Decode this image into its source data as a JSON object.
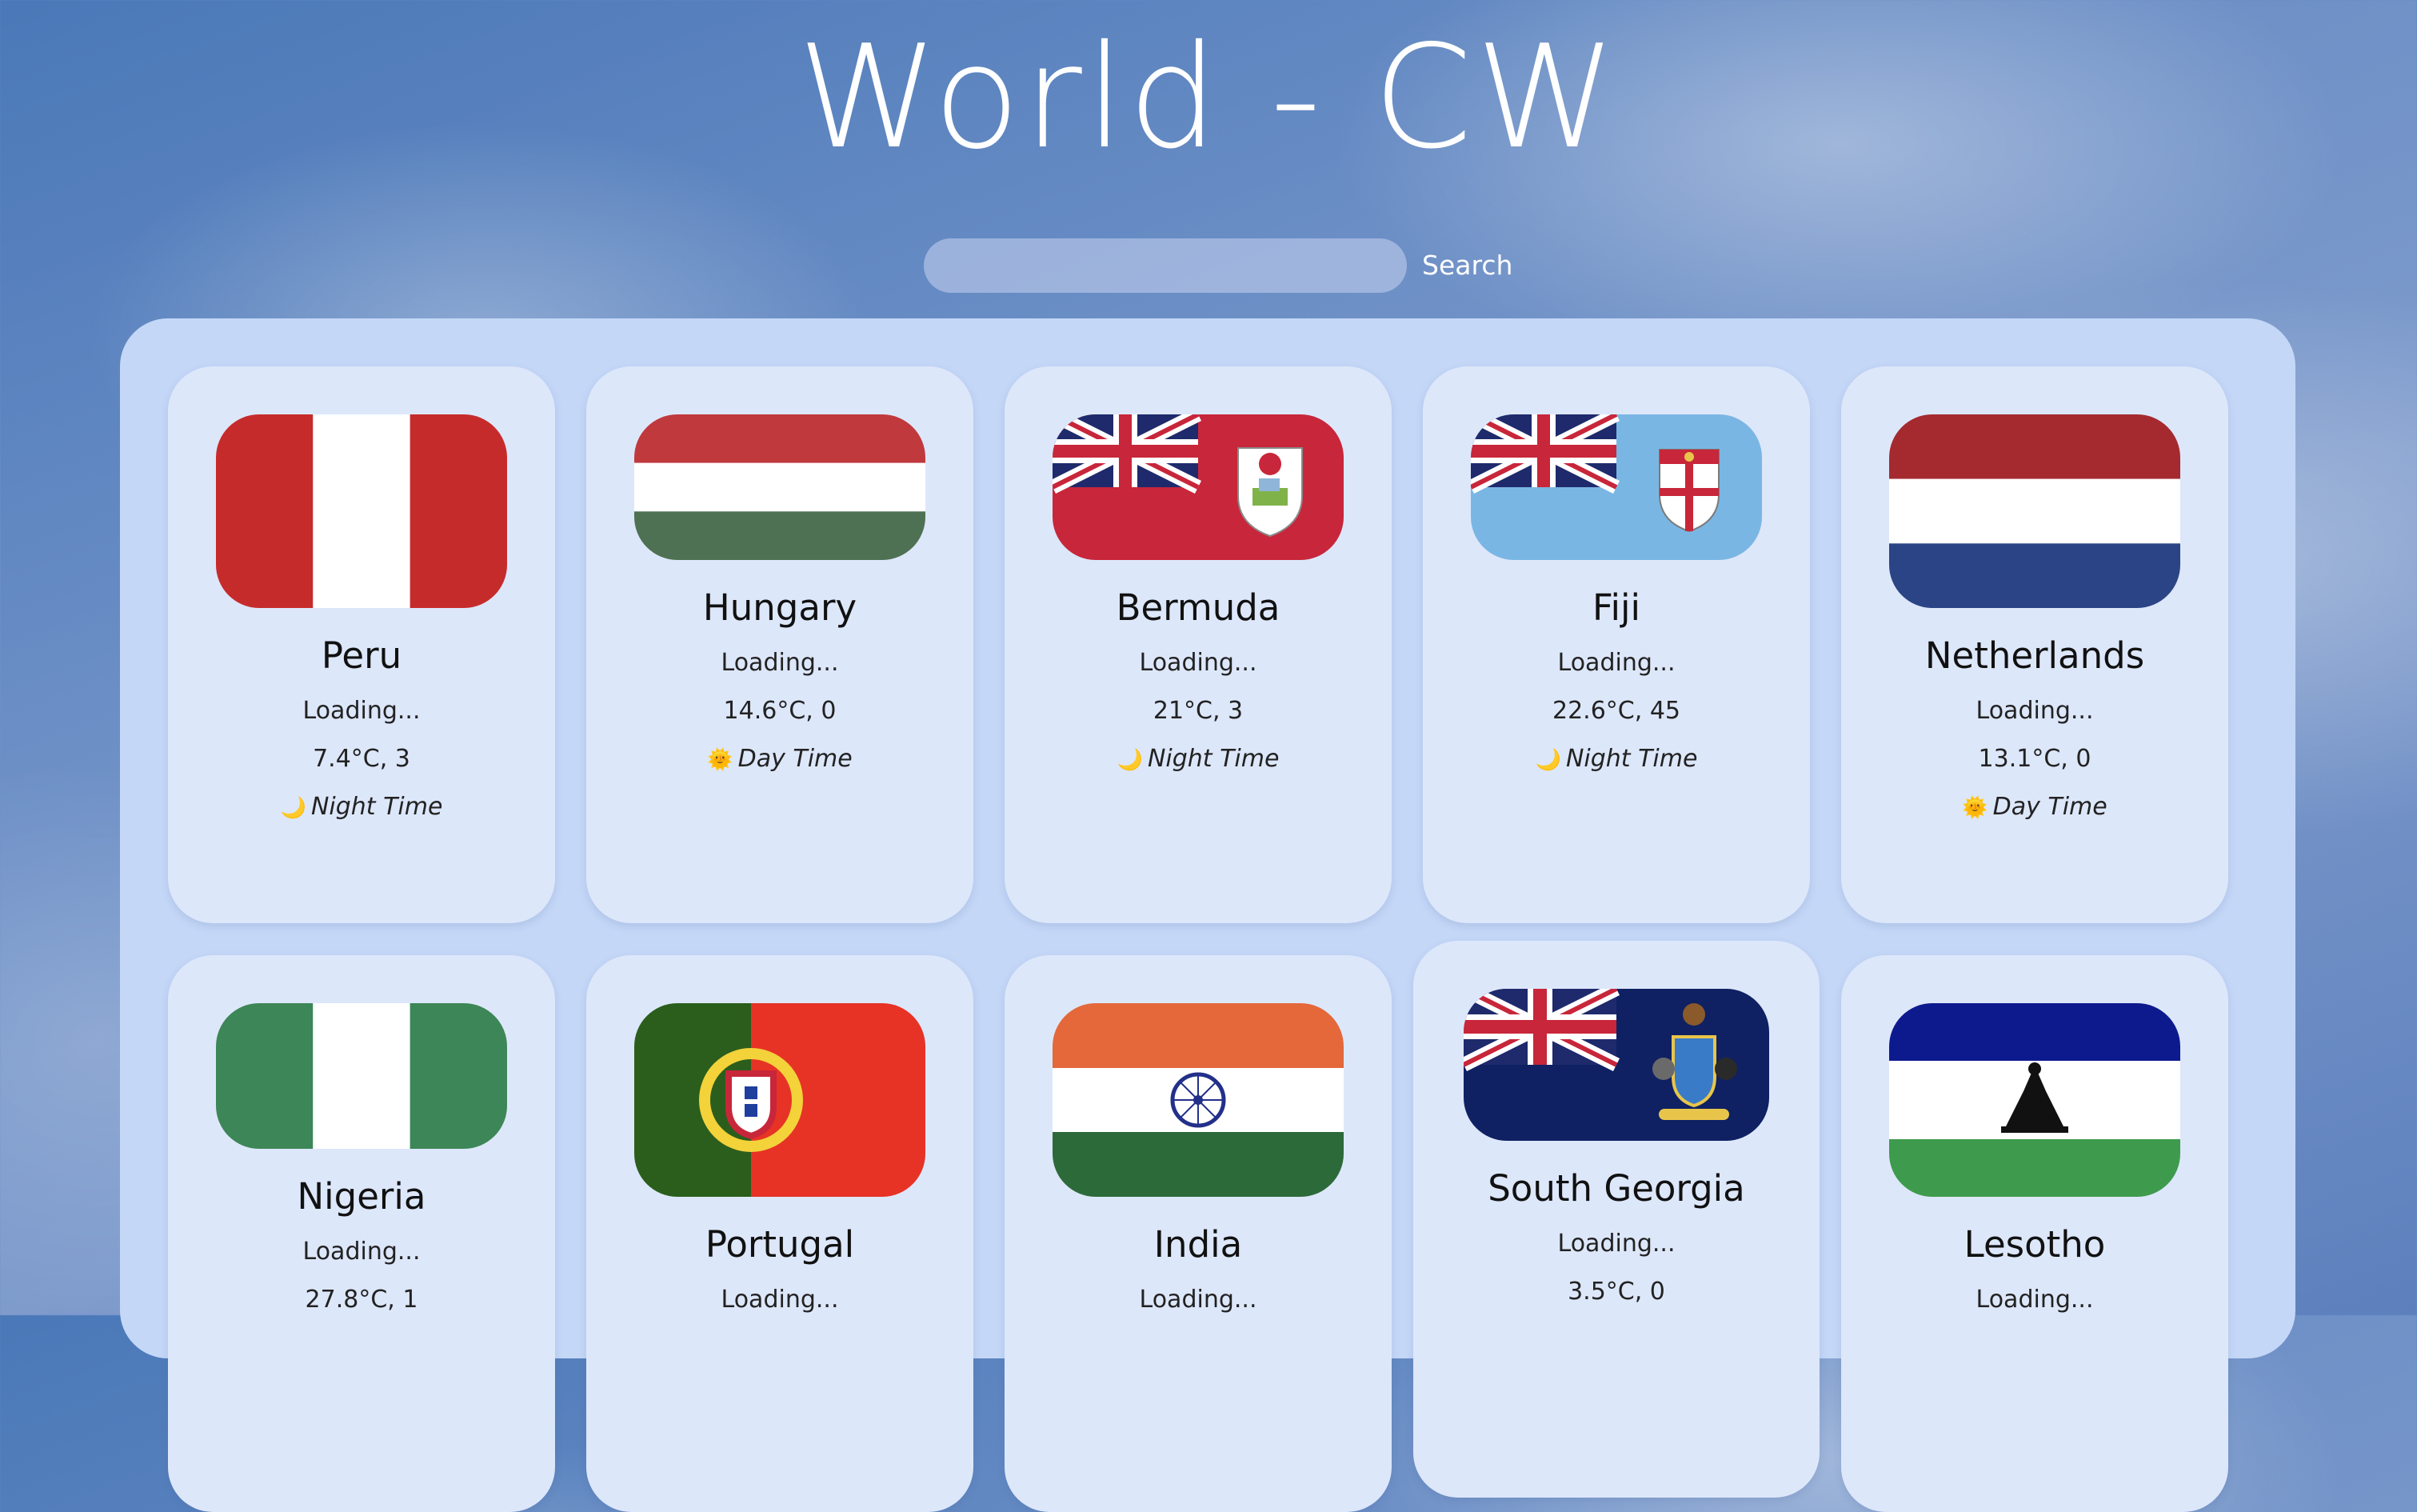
{
  "page_title": "World - CW",
  "search": {
    "placeholder": "",
    "value": "",
    "button_label": "Search"
  },
  "countries": [
    {
      "name": "Peru",
      "status": "Loading...",
      "weather": "7.4°C, 3",
      "time_icon": "🌙",
      "time_of_day": "Night Time"
    },
    {
      "name": "Hungary",
      "status": "Loading...",
      "weather": "14.6°C, 0",
      "time_icon": "🌞",
      "time_of_day": "Day Time"
    },
    {
      "name": "Bermuda",
      "status": "Loading...",
      "weather": "21°C, 3",
      "time_icon": "🌙",
      "time_of_day": "Night Time"
    },
    {
      "name": "Fiji",
      "status": "Loading...",
      "weather": "22.6°C, 45",
      "time_icon": "🌙",
      "time_of_day": "Night Time"
    },
    {
      "name": "Netherlands",
      "status": "Loading...",
      "weather": "13.1°C, 0",
      "time_icon": "🌞",
      "time_of_day": "Day Time"
    },
    {
      "name": "Nigeria",
      "status": "Loading...",
      "weather": "27.8°C, 1"
    },
    {
      "name": "Portugal",
      "status": "Loading..."
    },
    {
      "name": "India",
      "status": "Loading..."
    },
    {
      "name": "South Georgia",
      "status": "Loading...",
      "weather": "3.5°C, 0"
    },
    {
      "name": "Lesotho",
      "status": "Loading..."
    }
  ],
  "colors": {
    "panel": "#c4d7f7",
    "card": "#dde7fa",
    "title": "#ffffff"
  }
}
